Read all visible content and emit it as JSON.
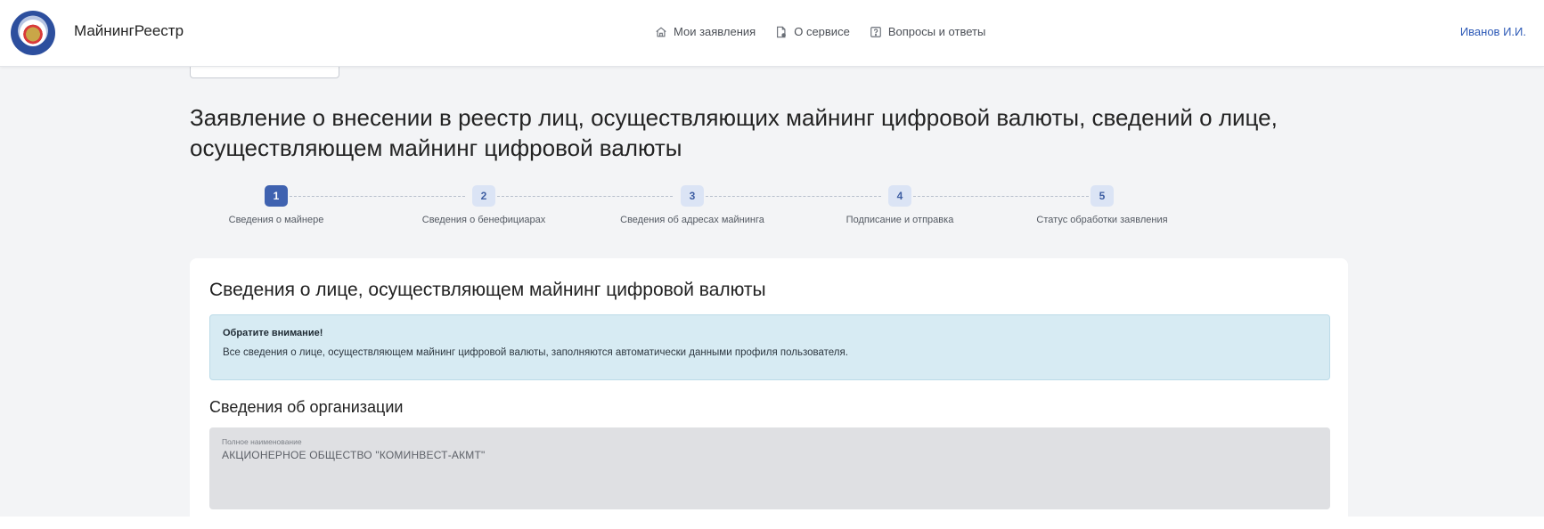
{
  "header": {
    "brand": "МайнингРеестр",
    "nav": [
      {
        "label": "Мои заявления",
        "icon": "home-icon"
      },
      {
        "label": "О сервисе",
        "icon": "document-gear-icon"
      },
      {
        "label": "Вопросы и ответы",
        "icon": "question-box-icon"
      }
    ],
    "user": "Иванов И.И."
  },
  "page": {
    "title": "Заявление о внесении в реестр лиц, осуществляющих майнинг цифровой валюты, сведений о лице, осуществляющем майнинг цифровой валюты"
  },
  "stepper": {
    "active_index": 0,
    "steps": [
      {
        "num": "1",
        "label": "Сведения о майнере"
      },
      {
        "num": "2",
        "label": "Сведения о бенефициарах"
      },
      {
        "num": "3",
        "label": "Сведения об адресах майнинга"
      },
      {
        "num": "4",
        "label": "Подписание и отправка"
      },
      {
        "num": "5",
        "label": "Статус обработки заявления"
      }
    ]
  },
  "card": {
    "title": "Сведения о лице, осуществляющем майнинг цифровой валюты",
    "notice": {
      "title": "Обратите внимание!",
      "text": "Все сведения о лице, осуществляющем майнинг цифровой валюты, заполняются автоматически данными профиля пользователя."
    },
    "section_title": "Сведения об организации",
    "field": {
      "label": "Полное наименование",
      "value": "АКЦИОНЕРНОЕ ОБЩЕСТВО \"КОМИНВЕСТ-АКМТ\""
    }
  },
  "colors": {
    "accent": "#3f62b0",
    "link": "#2f5bb7",
    "notice_bg": "#d7ebf3",
    "background": "#f3f4f6"
  }
}
